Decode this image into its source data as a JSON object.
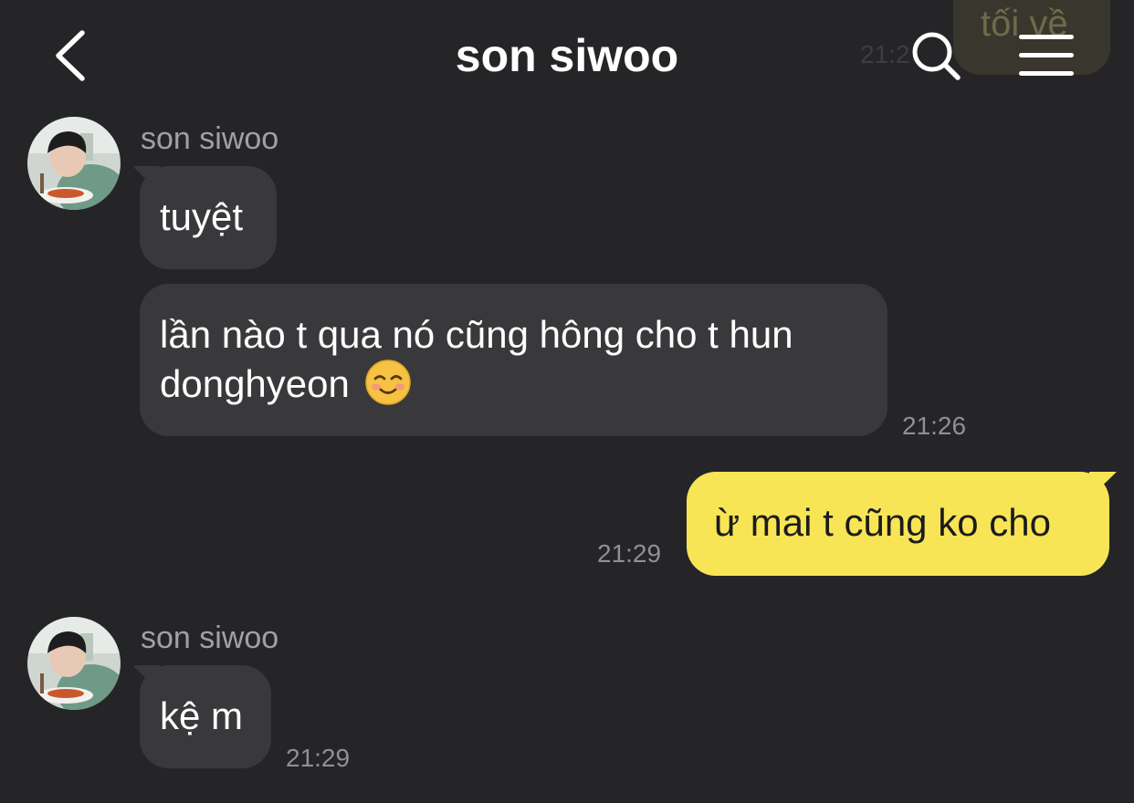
{
  "header": {
    "title": "son siwoo",
    "back_icon": "chevron-left-icon",
    "search_icon": "search-icon",
    "menu_icon": "hamburger-menu-icon",
    "ghost_message": "tối về",
    "ghost_time": "21:2"
  },
  "messages": [
    {
      "sender": "son siwoo",
      "text": "tuyệt"
    },
    {
      "line1": "lần nào t qua nó cũng hông cho t hun",
      "line2": "donghyeon",
      "emoji": "☺️",
      "time": "21:26"
    },
    {
      "text": "ừ mai t cũng ko cho",
      "time": "21:29"
    },
    {
      "sender": "son siwoo",
      "text": "kệ m",
      "time": "21:29"
    }
  ],
  "colors": {
    "background": "#252528",
    "incoming_bubble": "#39393c",
    "outgoing_bubble": "#f8e556",
    "meta_text": "#8f8f94"
  }
}
